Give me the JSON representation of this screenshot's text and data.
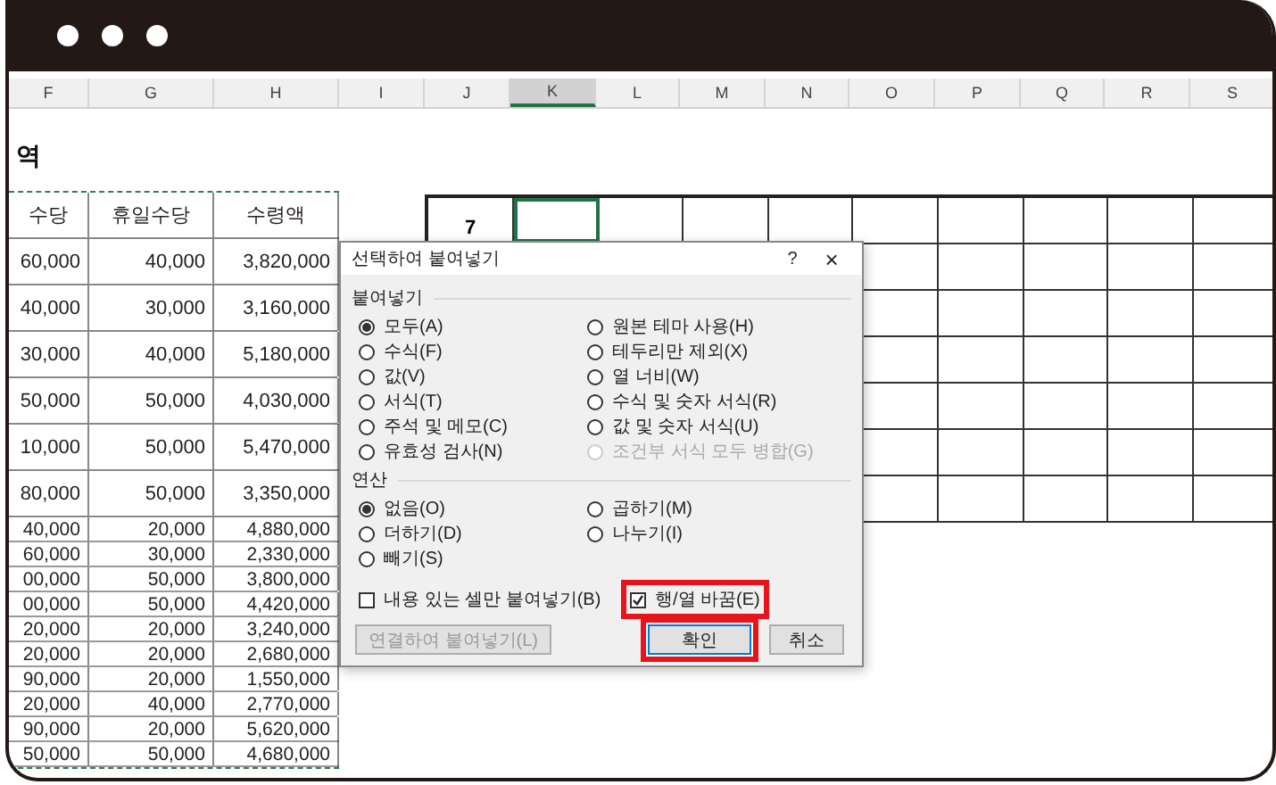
{
  "columns": [
    {
      "label": "F",
      "selected": false
    },
    {
      "label": "G",
      "selected": false
    },
    {
      "label": "H",
      "selected": false
    },
    {
      "label": "I",
      "selected": false
    },
    {
      "label": "J",
      "selected": false
    },
    {
      "label": "K",
      "selected": true
    },
    {
      "label": "L",
      "selected": false
    },
    {
      "label": "M",
      "selected": false
    },
    {
      "label": "N",
      "selected": false
    },
    {
      "label": "O",
      "selected": false
    },
    {
      "label": "P",
      "selected": false
    },
    {
      "label": "Q",
      "selected": false
    },
    {
      "label": "R",
      "selected": false
    },
    {
      "label": "S",
      "selected": false
    }
  ],
  "title": "역",
  "table": {
    "columns": [
      "수당",
      "휴일수당",
      "수령액"
    ],
    "rows": [
      {
        "cells": [
          "60,000",
          "40,000",
          "3,820,000"
        ],
        "tall": true
      },
      {
        "cells": [
          "40,000",
          "30,000",
          "3,160,000"
        ],
        "tall": true
      },
      {
        "cells": [
          "30,000",
          "40,000",
          "5,180,000"
        ],
        "tall": true
      },
      {
        "cells": [
          "50,000",
          "50,000",
          "4,030,000"
        ],
        "tall": true
      },
      {
        "cells": [
          "10,000",
          "50,000",
          "5,470,000"
        ],
        "tall": true
      },
      {
        "cells": [
          "80,000",
          "50,000",
          "3,350,000"
        ],
        "tall": true
      },
      {
        "cells": [
          "40,000",
          "20,000",
          "4,880,000"
        ],
        "tall": false
      },
      {
        "cells": [
          "60,000",
          "30,000",
          "2,330,000"
        ],
        "tall": false
      },
      {
        "cells": [
          "00,000",
          "50,000",
          "3,800,000"
        ],
        "tall": false
      },
      {
        "cells": [
          "00,000",
          "50,000",
          "4,420,000"
        ],
        "tall": false
      },
      {
        "cells": [
          "20,000",
          "20,000",
          "3,240,000"
        ],
        "tall": false
      },
      {
        "cells": [
          "20,000",
          "20,000",
          "2,680,000"
        ],
        "tall": false
      },
      {
        "cells": [
          "90,000",
          "20,000",
          "1,550,000"
        ],
        "tall": false
      },
      {
        "cells": [
          "20,000",
          "40,000",
          "2,770,000"
        ],
        "tall": false
      },
      {
        "cells": [
          "90,000",
          "20,000",
          "5,620,000"
        ],
        "tall": false
      },
      {
        "cells": [
          "50,000",
          "50,000",
          "4,680,000"
        ],
        "tall": false
      }
    ]
  },
  "grid": {
    "first_cell": "7"
  },
  "dialog": {
    "title": "선택하여 붙여넣기",
    "help": "?",
    "close": "×",
    "paste_section": "붙여넣기",
    "paste_options": [
      {
        "label": "모두(A)",
        "selected": true,
        "disabled": false
      },
      {
        "label": "수식(F)",
        "selected": false,
        "disabled": false
      },
      {
        "label": "값(V)",
        "selected": false,
        "disabled": false
      },
      {
        "label": "서식(T)",
        "selected": false,
        "disabled": false
      },
      {
        "label": "주석 및 메모(C)",
        "selected": false,
        "disabled": false
      },
      {
        "label": "유효성 검사(N)",
        "selected": false,
        "disabled": false
      },
      {
        "label": "원본 테마 사용(H)",
        "selected": false,
        "disabled": false
      },
      {
        "label": "테두리만 제외(X)",
        "selected": false,
        "disabled": false
      },
      {
        "label": "열 너비(W)",
        "selected": false,
        "disabled": false
      },
      {
        "label": "수식 및 숫자 서식(R)",
        "selected": false,
        "disabled": false
      },
      {
        "label": "값 및 숫자 서식(U)",
        "selected": false,
        "disabled": false
      },
      {
        "label": "조건부 서식 모두 병합(G)",
        "selected": false,
        "disabled": true
      }
    ],
    "operation_section": "연산",
    "operation_options": [
      {
        "label": "없음(O)",
        "selected": true
      },
      {
        "label": "더하기(D)",
        "selected": false
      },
      {
        "label": "빼기(S)",
        "selected": false
      },
      {
        "label": "곱하기(M)",
        "selected": false
      },
      {
        "label": "나누기(I)",
        "selected": false
      }
    ],
    "skip_blanks": {
      "label": "내용 있는 셀만 붙여넣기(B)",
      "checked": false
    },
    "transpose": {
      "label": "행/열 바꿈(E)",
      "checked": true,
      "highlighted": true
    },
    "paste_link": {
      "label": "연결하여 붙여넣기(L)",
      "disabled": true
    },
    "ok": {
      "label": "확인",
      "highlighted": true
    },
    "cancel": {
      "label": "취소",
      "highlighted": false
    }
  }
}
